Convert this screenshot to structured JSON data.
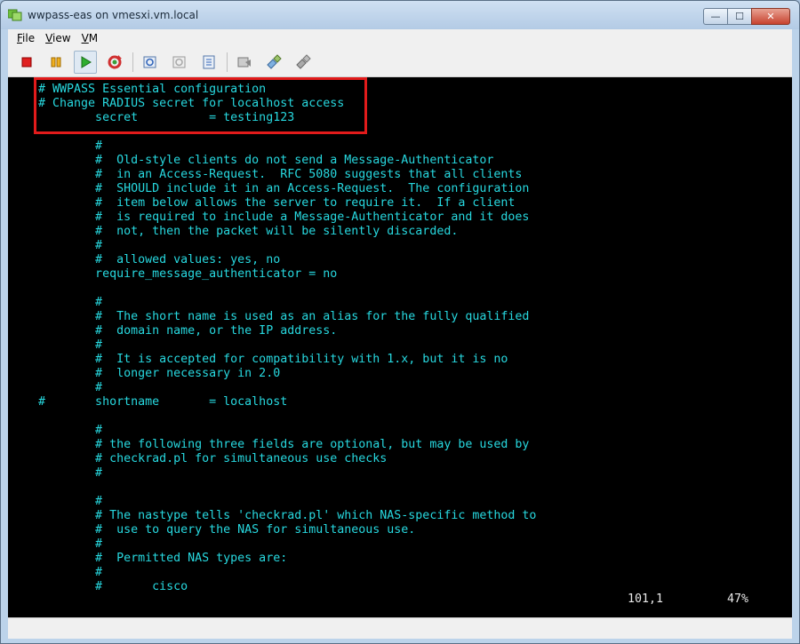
{
  "window": {
    "title": "wwpass-eas on vmesxi.vm.local",
    "buttons": {
      "minimize": "—",
      "maximize": "☐",
      "close": "✕"
    }
  },
  "menu": [
    {
      "underline": "F",
      "rest": "ile"
    },
    {
      "underline": "V",
      "rest": "iew"
    },
    {
      "underline": "V",
      "rest": "M"
    }
  ],
  "toolbar": {
    "icons": [
      "stop-icon",
      "pause-icon",
      "play-icon",
      "reset-icon",
      "snapshot-icon",
      "revert-snapshot-icon",
      "snapshot-manager-icon",
      "console-settings-icon",
      "connect-device-icon",
      "device-settings-icon"
    ]
  },
  "console": {
    "lines": [
      "   # WWPASS Essential configuration",
      "   # Change RADIUS secret for localhost access",
      "           secret          = testing123",
      "",
      "           #",
      "           #  Old-style clients do not send a Message-Authenticator",
      "           #  in an Access-Request.  RFC 5080 suggests that all clients",
      "           #  SHOULD include it in an Access-Request.  The configuration",
      "           #  item below allows the server to require it.  If a client",
      "           #  is required to include a Message-Authenticator and it does",
      "           #  not, then the packet will be silently discarded.",
      "           #",
      "           #  allowed values: yes, no",
      "           require_message_authenticator = no",
      "",
      "           #",
      "           #  The short name is used as an alias for the fully qualified",
      "           #  domain name, or the IP address.",
      "           #",
      "           #  It is accepted for compatibility with 1.x, but it is no",
      "           #  longer necessary in 2.0",
      "           #",
      "   #       shortname       = localhost",
      "",
      "           #",
      "           # the following three fields are optional, but may be used by",
      "           # checkrad.pl for simultaneous use checks",
      "           #",
      "",
      "           #",
      "           # The nastype tells 'checkrad.pl' which NAS-specific method to",
      "           #  use to query the NAS for simultaneous use.",
      "           #",
      "           #  Permitted NAS types are:",
      "           #",
      "           #       cisco"
    ],
    "status_position": "101,1",
    "status_percent": "47%"
  }
}
